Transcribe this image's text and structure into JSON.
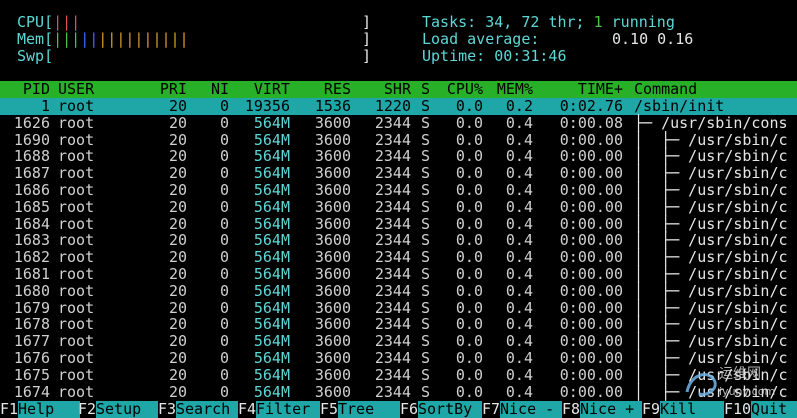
{
  "meters": {
    "cpu_label": "CPU[",
    "cpu_bar": "|||",
    "cpu_end": "]",
    "mem_label": "Mem[",
    "mem_bar_1": "|||",
    "mem_bar_2": "||",
    "mem_bar_3": "||||||||||",
    "mem_end": "]",
    "swp_label": "Swp[",
    "swp_end": "]"
  },
  "summary": {
    "tasks_label": "Tasks:",
    "tasks_value": "34,",
    "threads_value": "72",
    "threads_label": "thr;",
    "running_value": "1",
    "running_label": "running",
    "load_label": "Load average:",
    "load_values": "0.10 0.16",
    "uptime_label": "Uptime:",
    "uptime_value": "00:31:46"
  },
  "columns": {
    "pid": "PID",
    "user": "USER",
    "pri": "PRI",
    "ni": "NI",
    "virt": "VIRT",
    "res": "RES",
    "shr": "SHR",
    "s": "S",
    "cpu": "CPU%",
    "mem": "MEM%",
    "time": "TIME+",
    "command": "Command"
  },
  "processes": [
    {
      "pid": "1",
      "user": "root",
      "pri": "20",
      "ni": "0",
      "virt": "19356",
      "res": "1536",
      "shr": "1220",
      "s": "S",
      "cpu": "0.0",
      "mem": "0.2",
      "time": "0:02.76",
      "command": "/sbin/init"
    },
    {
      "pid": "1626",
      "user": "root",
      "pri": "20",
      "ni": "0",
      "virt": "564M",
      "res": "3600",
      "shr": "2344",
      "s": "S",
      "cpu": "0.0",
      "mem": "0.4",
      "time": "0:00.08",
      "command": "├─ /usr/sbin/cons"
    },
    {
      "pid": "1690",
      "user": "root",
      "pri": "20",
      "ni": "0",
      "virt": "564M",
      "res": "3600",
      "shr": "2344",
      "s": "S",
      "cpu": "0.0",
      "mem": "0.4",
      "time": "0:00.00",
      "command": "│  ├─ /usr/sbin/c"
    },
    {
      "pid": "1688",
      "user": "root",
      "pri": "20",
      "ni": "0",
      "virt": "564M",
      "res": "3600",
      "shr": "2344",
      "s": "S",
      "cpu": "0.0",
      "mem": "0.4",
      "time": "0:00.00",
      "command": "│  ├─ /usr/sbin/c"
    },
    {
      "pid": "1687",
      "user": "root",
      "pri": "20",
      "ni": "0",
      "virt": "564M",
      "res": "3600",
      "shr": "2344",
      "s": "S",
      "cpu": "0.0",
      "mem": "0.4",
      "time": "0:00.00",
      "command": "│  ├─ /usr/sbin/c"
    },
    {
      "pid": "1686",
      "user": "root",
      "pri": "20",
      "ni": "0",
      "virt": "564M",
      "res": "3600",
      "shr": "2344",
      "s": "S",
      "cpu": "0.0",
      "mem": "0.4",
      "time": "0:00.00",
      "command": "│  ├─ /usr/sbin/c"
    },
    {
      "pid": "1685",
      "user": "root",
      "pri": "20",
      "ni": "0",
      "virt": "564M",
      "res": "3600",
      "shr": "2344",
      "s": "S",
      "cpu": "0.0",
      "mem": "0.4",
      "time": "0:00.00",
      "command": "│  ├─ /usr/sbin/c"
    },
    {
      "pid": "1684",
      "user": "root",
      "pri": "20",
      "ni": "0",
      "virt": "564M",
      "res": "3600",
      "shr": "2344",
      "s": "S",
      "cpu": "0.0",
      "mem": "0.4",
      "time": "0:00.00",
      "command": "│  ├─ /usr/sbin/c"
    },
    {
      "pid": "1683",
      "user": "root",
      "pri": "20",
      "ni": "0",
      "virt": "564M",
      "res": "3600",
      "shr": "2344",
      "s": "S",
      "cpu": "0.0",
      "mem": "0.4",
      "time": "0:00.00",
      "command": "│  ├─ /usr/sbin/c"
    },
    {
      "pid": "1682",
      "user": "root",
      "pri": "20",
      "ni": "0",
      "virt": "564M",
      "res": "3600",
      "shr": "2344",
      "s": "S",
      "cpu": "0.0",
      "mem": "0.4",
      "time": "0:00.00",
      "command": "│  ├─ /usr/sbin/c"
    },
    {
      "pid": "1681",
      "user": "root",
      "pri": "20",
      "ni": "0",
      "virt": "564M",
      "res": "3600",
      "shr": "2344",
      "s": "S",
      "cpu": "0.0",
      "mem": "0.4",
      "time": "0:00.00",
      "command": "│  ├─ /usr/sbin/c"
    },
    {
      "pid": "1680",
      "user": "root",
      "pri": "20",
      "ni": "0",
      "virt": "564M",
      "res": "3600",
      "shr": "2344",
      "s": "S",
      "cpu": "0.0",
      "mem": "0.4",
      "time": "0:00.00",
      "command": "│  ├─ /usr/sbin/c"
    },
    {
      "pid": "1679",
      "user": "root",
      "pri": "20",
      "ni": "0",
      "virt": "564M",
      "res": "3600",
      "shr": "2344",
      "s": "S",
      "cpu": "0.0",
      "mem": "0.4",
      "time": "0:00.00",
      "command": "│  ├─ /usr/sbin/c"
    },
    {
      "pid": "1678",
      "user": "root",
      "pri": "20",
      "ni": "0",
      "virt": "564M",
      "res": "3600",
      "shr": "2344",
      "s": "S",
      "cpu": "0.0",
      "mem": "0.4",
      "time": "0:00.00",
      "command": "│  ├─ /usr/sbin/c"
    },
    {
      "pid": "1677",
      "user": "root",
      "pri": "20",
      "ni": "0",
      "virt": "564M",
      "res": "3600",
      "shr": "2344",
      "s": "S",
      "cpu": "0.0",
      "mem": "0.4",
      "time": "0:00.00",
      "command": "│  ├─ /usr/sbin/c"
    },
    {
      "pid": "1676",
      "user": "root",
      "pri": "20",
      "ni": "0",
      "virt": "564M",
      "res": "3600",
      "shr": "2344",
      "s": "S",
      "cpu": "0.0",
      "mem": "0.4",
      "time": "0:00.00",
      "command": "│  ├─ /usr/sbin/c"
    },
    {
      "pid": "1675",
      "user": "root",
      "pri": "20",
      "ni": "0",
      "virt": "564M",
      "res": "3600",
      "shr": "2344",
      "s": "S",
      "cpu": "0.0",
      "mem": "0.4",
      "time": "0:00.00",
      "command": "│  ├─ /usr/sbin/c"
    },
    {
      "pid": "1674",
      "user": "root",
      "pri": "20",
      "ni": "0",
      "virt": "564M",
      "res": "3600",
      "shr": "2344",
      "s": "S",
      "cpu": "0.0",
      "mem": "0.4",
      "time": "0:00.00",
      "command": "│  ├─ /usr/sbin/c"
    }
  ],
  "function_keys": [
    {
      "key": "F1",
      "label": "Help"
    },
    {
      "key": "F2",
      "label": "Setup"
    },
    {
      "key": "F3",
      "label": "Search"
    },
    {
      "key": "F4",
      "label": "Filter"
    },
    {
      "key": "F5",
      "label": "Tree"
    },
    {
      "key": "F6",
      "label": "SortBy"
    },
    {
      "key": "F7",
      "label": "Nice -"
    },
    {
      "key": "F8",
      "label": "Nice +"
    },
    {
      "key": "F9",
      "label": "Kill"
    },
    {
      "key": "F10",
      "label": "Quit"
    }
  ],
  "watermark": {
    "text": "运维网",
    "url": "iyunv.com"
  },
  "colors": {
    "header_green": "#28b028",
    "selection_cyan": "#1fa7a7",
    "label_cyan": "#5fd7d7",
    "value_green": "#49c449"
  }
}
